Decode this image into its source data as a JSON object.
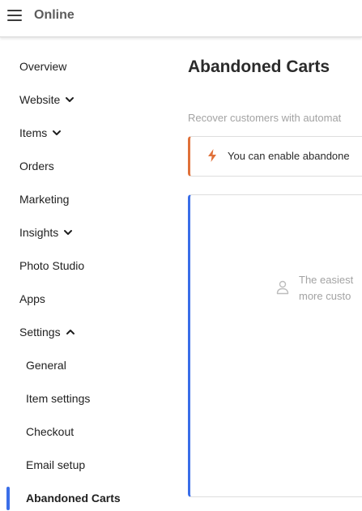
{
  "app": {
    "title": "Online"
  },
  "sidebar": {
    "items": [
      {
        "label": "Overview"
      },
      {
        "label": "Website"
      },
      {
        "label": "Items"
      },
      {
        "label": "Orders"
      },
      {
        "label": "Marketing"
      },
      {
        "label": "Insights"
      },
      {
        "label": "Photo Studio"
      },
      {
        "label": "Apps"
      },
      {
        "label": "Settings"
      }
    ],
    "settings_subitems": [
      {
        "label": "General"
      },
      {
        "label": "Item settings"
      },
      {
        "label": "Checkout"
      },
      {
        "label": "Email setup"
      },
      {
        "label": "Abandoned Carts"
      }
    ]
  },
  "main": {
    "title": "Abandoned Carts",
    "subtitle": "Recover customers with automat",
    "notice": {
      "text": "You can enable abandone",
      "icon": "lightning-bolt-icon",
      "accent": "#e0713a"
    },
    "panel": {
      "accent": "#3a6ee8",
      "empty_line1": "The easiest",
      "empty_line2": "more custo",
      "icon": "person-icon"
    }
  },
  "colors": {
    "active": "#3a6ee8",
    "muted_text": "#a3a3a3"
  }
}
